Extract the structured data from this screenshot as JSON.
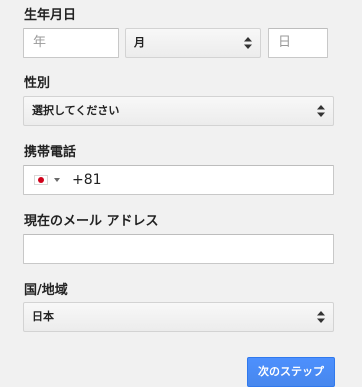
{
  "birthday": {
    "label": "生年月日",
    "year_placeholder": "年",
    "month_value": "月",
    "day_placeholder": "日"
  },
  "gender": {
    "label": "性別",
    "selected": "選択してください"
  },
  "phone": {
    "label": "携帯電話",
    "country_flag": "flag-japan-icon",
    "country_code": "+81"
  },
  "email": {
    "label": "現在のメール アドレス",
    "value": ""
  },
  "country": {
    "label": "国/地域",
    "selected": "日本"
  },
  "actions": {
    "next_label": "次のステップ"
  },
  "colors": {
    "background": "#f1f1f1",
    "button_blue": "#4d90fe",
    "flag_red": "#d0021b"
  }
}
